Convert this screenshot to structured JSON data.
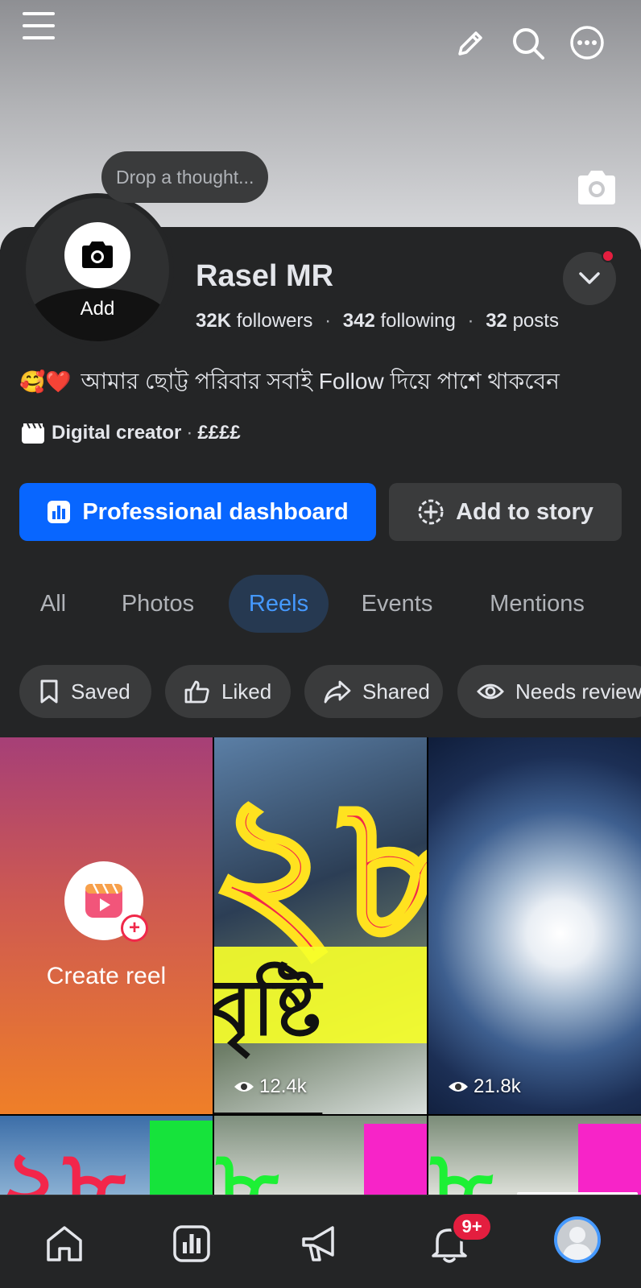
{
  "cover": {
    "menu_icon": "hamburger-icon",
    "edit_icon": "pencil-icon",
    "search_icon": "search-icon",
    "more_icon": "more-icon",
    "camera_icon": "camera-icon"
  },
  "thought": {
    "placeholder": "Drop a thought..."
  },
  "avatar": {
    "add_label": "Add"
  },
  "profile": {
    "name": "Rasel MR",
    "followers_count": "32K",
    "followers_label": "followers",
    "following_count": "342",
    "following_label": "following",
    "posts_count": "32",
    "posts_label": "posts",
    "bio_emoji": "🥰❤️",
    "bio": "আমার ছোট্ট পরিবার সবাই Follow দিয়ে পাশে থাকবেন",
    "category": "Digital creator",
    "price_range": "££££"
  },
  "buttons": {
    "dashboard": "Professional dashboard",
    "add_story": "Add to story"
  },
  "tabs": [
    {
      "label": "All",
      "active": false
    },
    {
      "label": "Photos",
      "active": false
    },
    {
      "label": "Reels",
      "active": true
    },
    {
      "label": "Events",
      "active": false
    },
    {
      "label": "Mentions",
      "active": false
    }
  ],
  "chips": [
    {
      "label": "Saved",
      "icon": "bookmark-icon"
    },
    {
      "label": "Liked",
      "icon": "thumbs-up-icon"
    },
    {
      "label": "Shared",
      "icon": "share-icon"
    },
    {
      "label": "Needs review",
      "icon": "eye-icon"
    }
  ],
  "reels": {
    "create_label": "Create reel",
    "items": [
      {
        "views": "12.4k"
      },
      {
        "views": "21.8k"
      }
    ]
  },
  "nav": {
    "notifications_badge": "9+",
    "items": [
      "home-icon",
      "dashboard-icon",
      "megaphone-icon",
      "bell-icon",
      "profile-avatar"
    ]
  },
  "colors": {
    "accent": "#0866ff",
    "active_tab_bg": "#263951",
    "active_tab_text": "#4599ff",
    "badge": "#e41e3f"
  }
}
